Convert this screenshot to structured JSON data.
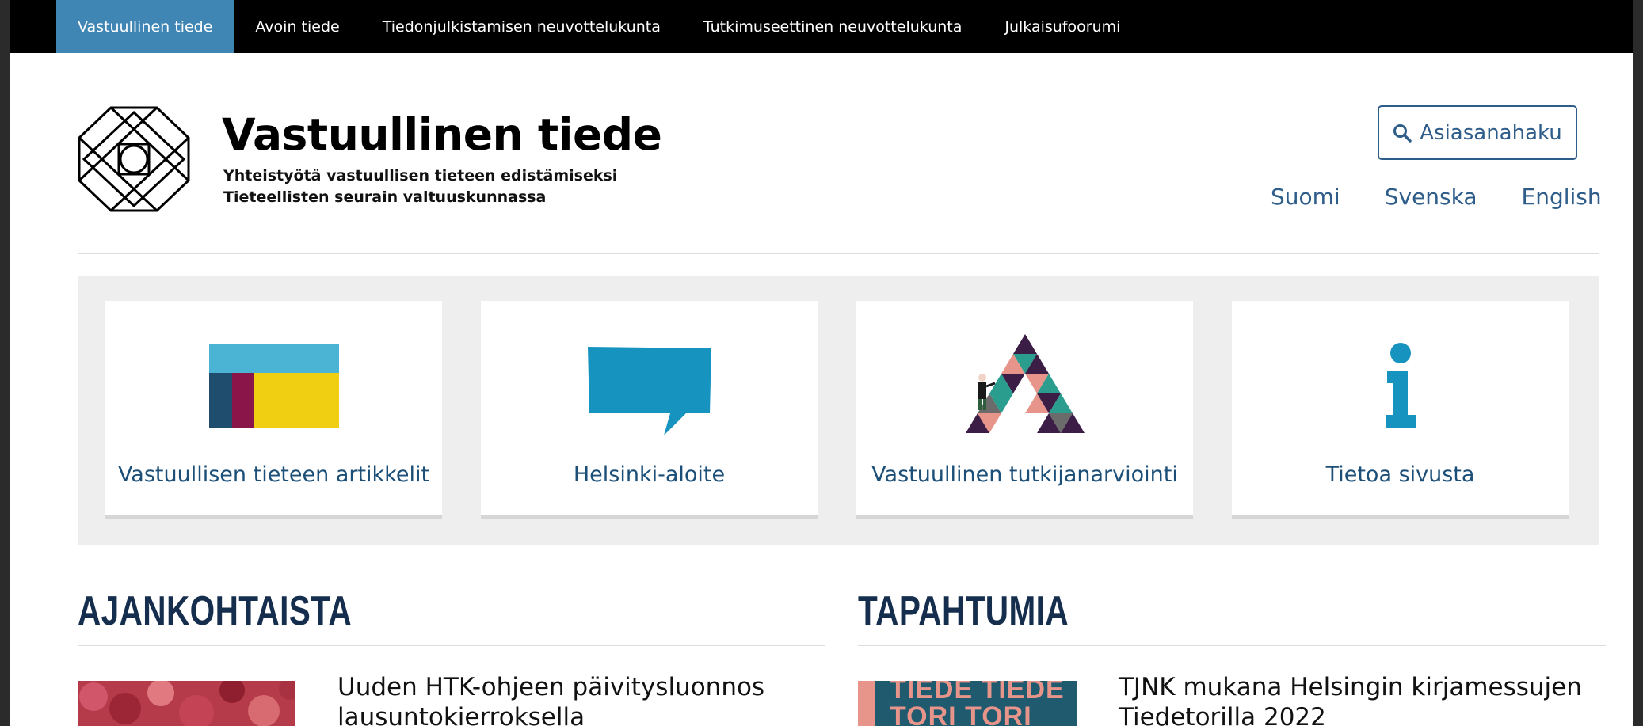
{
  "topnav": {
    "items": [
      {
        "label": "Vastuullinen tiede",
        "active": true
      },
      {
        "label": "Avoin tiede"
      },
      {
        "label": "Tiedonjulkistamisen neuvottelukunta"
      },
      {
        "label": "Tutkimuseettinen neuvottelukunta"
      },
      {
        "label": "Julkaisufoorumi"
      }
    ]
  },
  "header": {
    "title": "Vastuullinen tiede",
    "subtitle_line1": "Yhteistyötä vastuullisen tieteen edistämiseksi",
    "subtitle_line2": "Tieteellisten seurain valtuuskunnassa",
    "search_label": "Asiasanahaku",
    "languages": [
      "Suomi",
      "Svenska",
      "English"
    ]
  },
  "tiles": [
    {
      "label": "Vastuullisen tieteen artikkelit",
      "icon": "color-blocks-icon"
    },
    {
      "label": "Helsinki-aloite",
      "icon": "speech-bubble-icon"
    },
    {
      "label": "Vastuullinen tutkijanarviointi",
      "icon": "triangle-mosaic-icon"
    },
    {
      "label": "Tietoa sivusta",
      "icon": "info-icon"
    }
  ],
  "news": {
    "heading": "AJANKOHTAISTA",
    "item_title_line1": "Uuden HTK-ohjeen päivitysluonnos",
    "item_title_line2": "lausuntokierroksella"
  },
  "events": {
    "heading": "TAPAHTUMIA",
    "thumb_text_line1": "TIEDE TIEDE",
    "thumb_text_line2": "TORI TORI",
    "item_title_line1": "TJNK mukana Helsingin kirjamessujen",
    "item_title_line2": "Tiedetorilla 2022"
  },
  "colors": {
    "nav_active": "#3f86b5",
    "link_blue": "#2f5d8a",
    "tile_label": "#1c4f78",
    "heading_navy": "#152e4e"
  }
}
